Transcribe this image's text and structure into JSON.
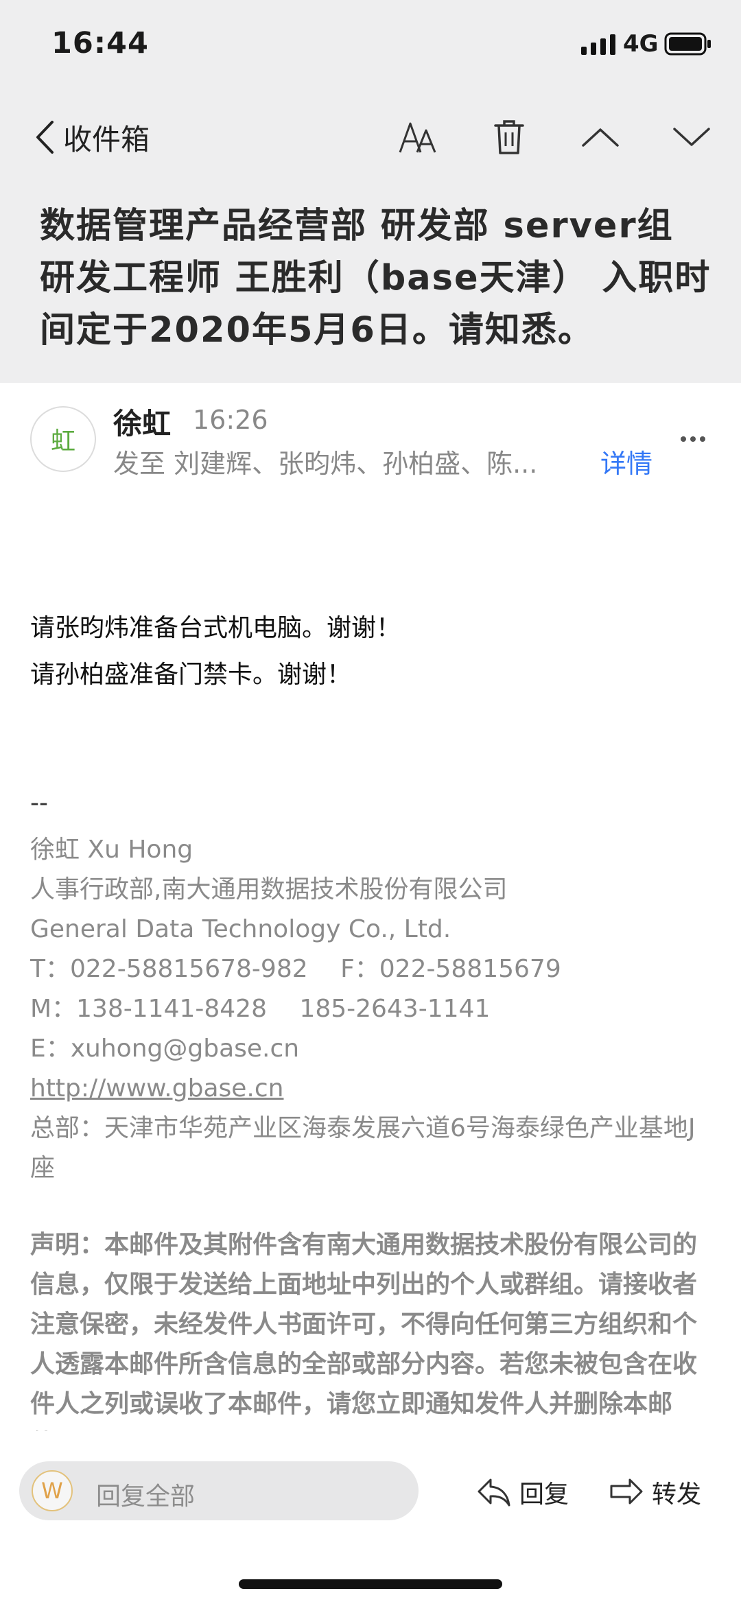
{
  "status": {
    "time": "16:44",
    "network": "4G"
  },
  "nav": {
    "back_label": "收件箱",
    "icons": [
      "font-size-icon",
      "trash-icon",
      "chevron-up-icon",
      "chevron-down-icon"
    ]
  },
  "subject": "数据管理产品经营部 研发部 server组 研发工程师 王胜利（base天津） 入职时间定于2020年5月6日。请知悉。",
  "sender": {
    "avatar_text": "虹",
    "name": "徐虹",
    "time": "16:26",
    "recipients": "发至 刘建辉、张昀炜、孙柏盛、陈...",
    "details_label": "详情"
  },
  "body": {
    "line1": "请张昀炜准备台式机电脑。谢谢！",
    "line2": "请孙柏盛准备门禁卡。谢谢！"
  },
  "signature": {
    "dashes": "--",
    "name": "徐虹 Xu Hong",
    "dept": "人事行政部,南大通用数据技术股份有限公司",
    "company": "General Data Technology Co., Ltd.",
    "phone": "T：022-58815678-982　 F：022-58815679",
    "mobile": "M：138-1141-8428　 185-2643-1141",
    "email": "E：xuhong@gbase.cn",
    "website": "http://www.gbase.cn",
    "address": "总部：天津市华苑产业区海泰发展六道6号海泰绿色产业基地J座"
  },
  "disclaimer": "声明：本邮件及其附件含有南大通用数据技术股份有限公司的信息，仅限于发送给上面地址中列出的个人或群组。请接收者注意保密，未经发件人书面许可，不得向任何第三方组织和个人透露本邮件所含信息的全部或部分内容。若您未被包含在收件人之列或误收了本邮件，请您立即通知发件人并删除本邮件！",
  "bottom": {
    "avatar_text": "W",
    "reply_all_placeholder": "回复全部",
    "reply_label": "回复",
    "forward_label": "转发"
  }
}
